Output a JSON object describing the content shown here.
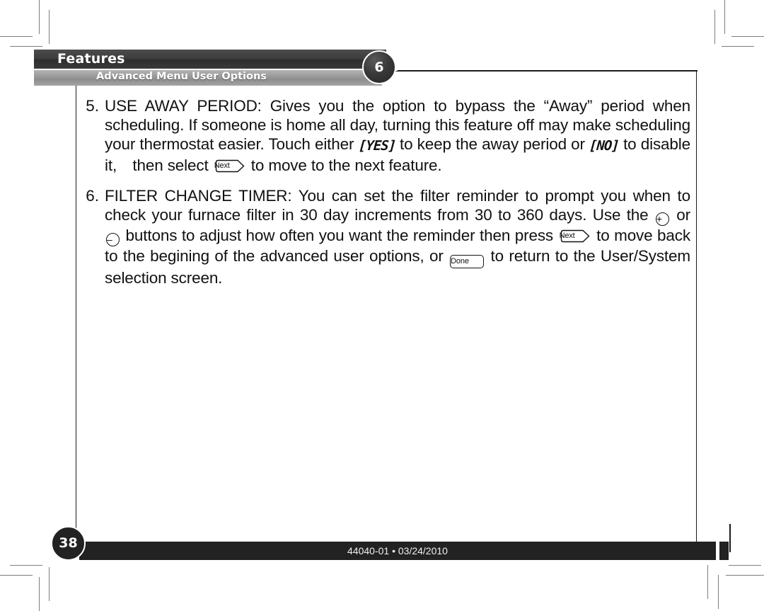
{
  "header": {
    "title": "Features",
    "subtitle": "Advanced Menu User Options",
    "chapter_badge": "6"
  },
  "content": {
    "items": [
      {
        "number": "5.",
        "lines": [
          [
            {
              "t": "text",
              "v": "USE AWAY PERIOD: Gives you the option to bypass the “Away” period when"
            }
          ],
          [
            {
              "t": "text",
              "v": "scheduling. If someone is home all day, turning this feature off may make scheduling"
            }
          ],
          [
            {
              "t": "text",
              "v": "your thermostat easier. Touch either "
            },
            {
              "t": "lcd",
              "v": "[YES]"
            },
            {
              "t": "text",
              "v": " to keep the away period or "
            },
            {
              "t": "lcd",
              "v": "[NO]"
            },
            {
              "t": "text",
              "v": " to disable"
            }
          ],
          [
            {
              "t": "text",
              "v": "it, then select "
            },
            {
              "t": "btn-next",
              "v": "Next"
            },
            {
              "t": "text",
              "v": " to move to the next feature."
            }
          ]
        ]
      },
      {
        "number": "6.",
        "lines": [
          [
            {
              "t": "text",
              "v": "FILTER CHANGE TIMER: You can set the filter reminder to prompt you when to"
            }
          ],
          [
            {
              "t": "text",
              "v": "check your furnace filter in 30 day increments from 30 to 360 days. Use the "
            },
            {
              "t": "btn-round",
              "v": "+"
            },
            {
              "t": "text",
              "v": " or"
            }
          ],
          [
            {
              "t": "btn-round",
              "v": "–"
            },
            {
              "t": "text",
              "v": " buttons to adjust how often you want the reminder then press "
            },
            {
              "t": "btn-next",
              "v": "Next"
            },
            {
              "t": "text",
              "v": " to move back"
            }
          ],
          [
            {
              "t": "text",
              "v": "to the begining of the advanced user options, or "
            },
            {
              "t": "btn-done",
              "v": "Done"
            },
            {
              "t": "text",
              "v": " to return to the User/System"
            }
          ],
          [
            {
              "t": "text",
              "v": "selection screen."
            }
          ]
        ]
      }
    ]
  },
  "footer": {
    "page_number": "38",
    "document_code": "44040-01 • 03/24/2010"
  }
}
